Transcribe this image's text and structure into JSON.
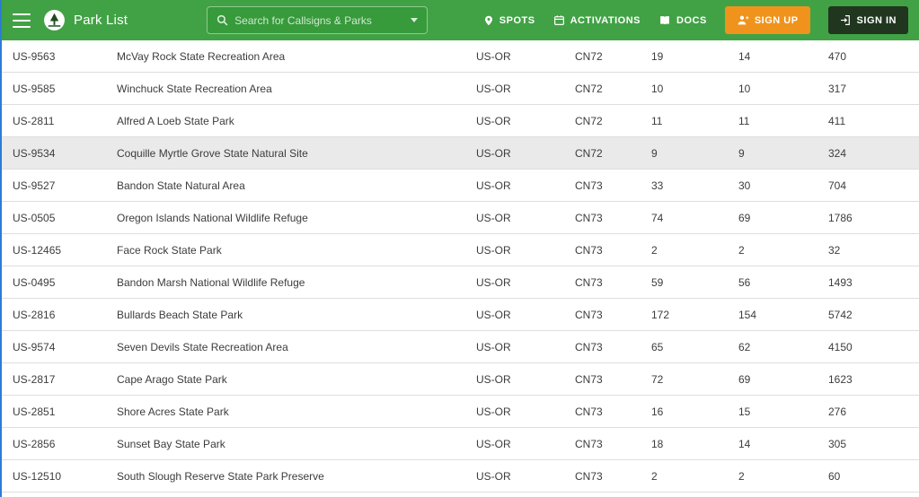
{
  "colors": {
    "header_green": "#41a245",
    "search_bg": "#379a3b",
    "search_border": "#8fcb8f",
    "signup_orange": "#f0931d",
    "signin_dark": "#20361f",
    "row_highlight": "#eaeaea",
    "edge_blue": "#2e7bd6"
  },
  "header": {
    "title": "Park List",
    "search_placeholder": "Search for Callsigns & Parks",
    "nav": {
      "spots": "SPOTS",
      "activations": "ACTIVATIONS",
      "docs": "DOCS"
    },
    "signup_label": "SIGN UP",
    "signin_label": "SIGN IN"
  },
  "table": {
    "rows": [
      {
        "reference": "US-9563",
        "name": "McVay Rock State Recreation Area",
        "location": "US-OR",
        "grid": "CN72",
        "attempts": "19",
        "activations": "14",
        "qsos": "470"
      },
      {
        "reference": "US-9585",
        "name": "Winchuck State Recreation Area",
        "location": "US-OR",
        "grid": "CN72",
        "attempts": "10",
        "activations": "10",
        "qsos": "317"
      },
      {
        "reference": "US-2811",
        "name": "Alfred A Loeb State Park",
        "location": "US-OR",
        "grid": "CN72",
        "attempts": "11",
        "activations": "11",
        "qsos": "411"
      },
      {
        "reference": "US-9534",
        "name": "Coquille Myrtle Grove State Natural Site",
        "location": "US-OR",
        "grid": "CN72",
        "attempts": "9",
        "activations": "9",
        "qsos": "324",
        "highlighted": true
      },
      {
        "reference": "US-9527",
        "name": "Bandon State Natural Area",
        "location": "US-OR",
        "grid": "CN73",
        "attempts": "33",
        "activations": "30",
        "qsos": "704"
      },
      {
        "reference": "US-0505",
        "name": "Oregon Islands National Wildlife Refuge",
        "location": "US-OR",
        "grid": "CN73",
        "attempts": "74",
        "activations": "69",
        "qsos": "1786"
      },
      {
        "reference": "US-12465",
        "name": "Face Rock State Park",
        "location": "US-OR",
        "grid": "CN73",
        "attempts": "2",
        "activations": "2",
        "qsos": "32"
      },
      {
        "reference": "US-0495",
        "name": "Bandon Marsh National Wildlife Refuge",
        "location": "US-OR",
        "grid": "CN73",
        "attempts": "59",
        "activations": "56",
        "qsos": "1493"
      },
      {
        "reference": "US-2816",
        "name": "Bullards Beach State Park",
        "location": "US-OR",
        "grid": "CN73",
        "attempts": "172",
        "activations": "154",
        "qsos": "5742"
      },
      {
        "reference": "US-9574",
        "name": "Seven Devils State Recreation Area",
        "location": "US-OR",
        "grid": "CN73",
        "attempts": "65",
        "activations": "62",
        "qsos": "4150"
      },
      {
        "reference": "US-2817",
        "name": "Cape Arago State Park",
        "location": "US-OR",
        "grid": "CN73",
        "attempts": "72",
        "activations": "69",
        "qsos": "1623"
      },
      {
        "reference": "US-2851",
        "name": "Shore Acres State Park",
        "location": "US-OR",
        "grid": "CN73",
        "attempts": "16",
        "activations": "15",
        "qsos": "276"
      },
      {
        "reference": "US-2856",
        "name": "Sunset Bay State Park",
        "location": "US-OR",
        "grid": "CN73",
        "attempts": "18",
        "activations": "14",
        "qsos": "305"
      },
      {
        "reference": "US-12510",
        "name": "South Slough Reserve State Park Preserve",
        "location": "US-OR",
        "grid": "CN73",
        "attempts": "2",
        "activations": "2",
        "qsos": "60"
      }
    ]
  }
}
